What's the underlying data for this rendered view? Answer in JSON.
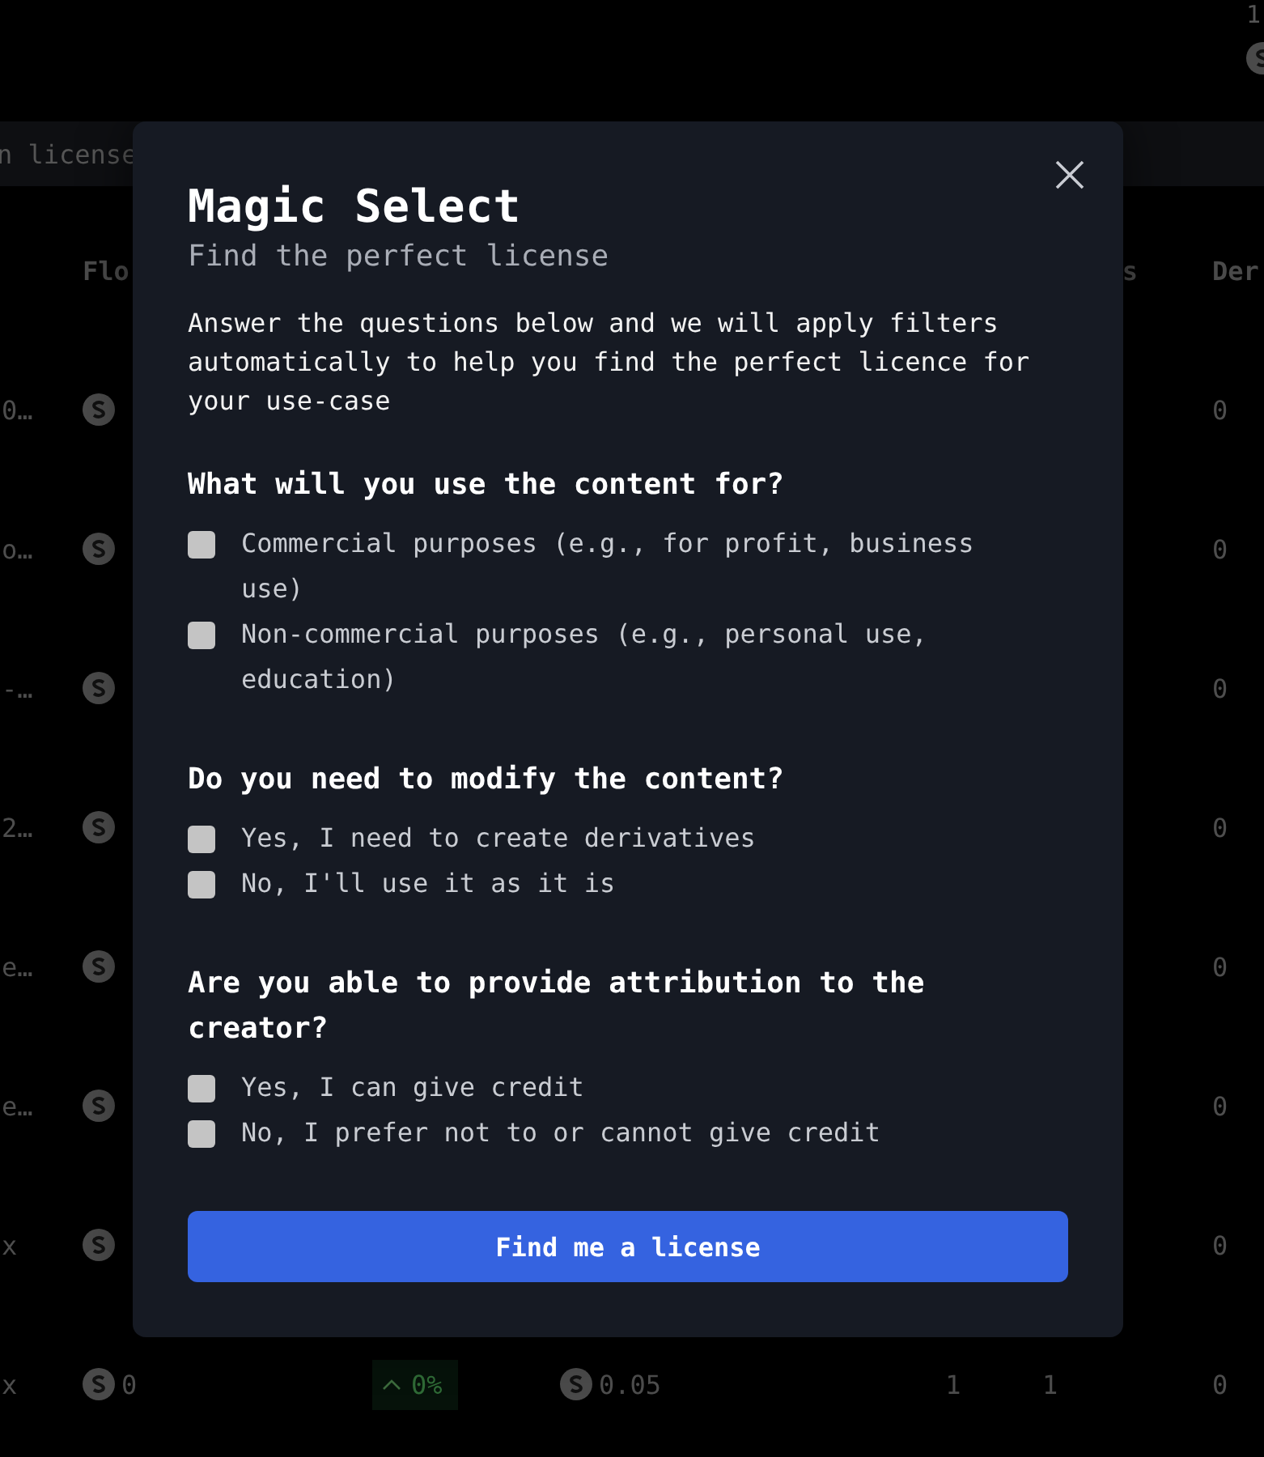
{
  "top_corner": {
    "count": "1"
  },
  "search": {
    "value": "n license"
  },
  "table": {
    "columns": [
      "Flo",
      "s",
      "Der"
    ],
    "rows": [
      {
        "column_1": "0…",
        "column_7": "0"
      },
      {
        "column_1": "o…",
        "column_7": "0"
      },
      {
        "column_1": "-…",
        "column_7": "0"
      },
      {
        "column_1": "2…",
        "column_7": "0"
      },
      {
        "column_1": "e…",
        "column_7": "0"
      },
      {
        "column_1": "e…",
        "column_7": "0"
      },
      {
        "column_1": "x",
        "column_7": "0"
      },
      {
        "column_1": "x",
        "column_2": "0",
        "column_3": "0%",
        "column_4": "0.05",
        "column_5": "1",
        "column_6": "1",
        "column_7": "0"
      }
    ]
  },
  "modal": {
    "title": "Magic Select",
    "subtitle": "Find the perfect license",
    "description": "Answer the questions below and we will apply filters automatically to help you find the perfect licence for your use-case",
    "questions": [
      {
        "question": "What will you use the content for?",
        "options": [
          {
            "label": "Commercial purposes (e.g., for profit, business use)",
            "checked": false
          },
          {
            "label": "Non-commercial purposes (e.g., personal use, education)",
            "checked": false
          }
        ]
      },
      {
        "question": "Do you need to modify the content?",
        "options": [
          {
            "label": "Yes, I need to create derivatives",
            "checked": false
          },
          {
            "label": "No, I'll use it as it is",
            "checked": false
          }
        ]
      },
      {
        "question": "Are you able to provide attribution to the creator?",
        "options": [
          {
            "label": "Yes, I can give credit",
            "checked": false
          },
          {
            "label": "No, I prefer not to or cannot give credit",
            "checked": false
          }
        ]
      }
    ],
    "button": "Find me a license"
  }
}
